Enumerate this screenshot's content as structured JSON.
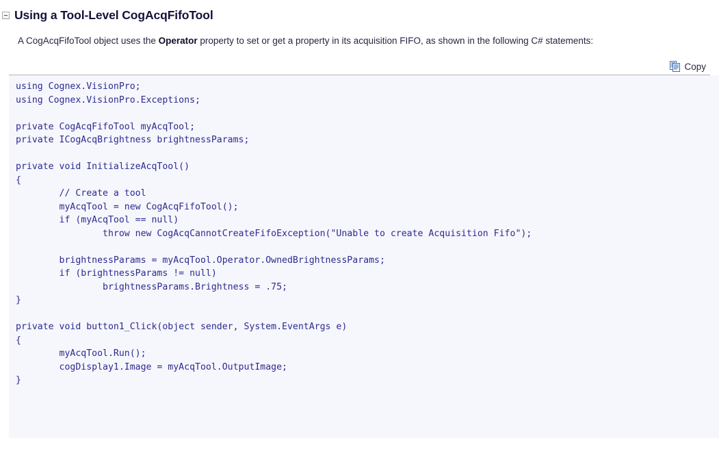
{
  "heading": {
    "collapse_icon": "minus-square-icon",
    "title": "Using a Tool-Level CogAcqFifoTool",
    "expanded": true
  },
  "intro": {
    "before_bold": "A CogAcqFifoTool object uses the ",
    "bold": "Operator",
    "after_bold": " property to set or get a property in its acquisition FIFO, as shown in the following C# statements:",
    "full_text": "A CogAcqFifoTool object uses the Operator property to set or get a property in its acquisition FIFO, as shown in the following C# statements:"
  },
  "code_toolbar": {
    "copy_icon": "copy-pages-icon",
    "copy_label": "Copy"
  },
  "code_block": {
    "language": "C#",
    "background_color": "#f6f6fd",
    "text_color": "#2b2b8f",
    "lines": [
      "using Cognex.VisionPro;",
      "using Cognex.VisionPro.Exceptions;",
      "",
      "private CogAcqFifoTool myAcqTool;",
      "private ICogAcqBrightness brightnessParams;",
      "",
      "private void InitializeAcqTool()",
      "{",
      "        // Create a tool",
      "        myAcqTool = new CogAcqFifoTool();",
      "        if (myAcqTool == null)",
      "                throw new CogAcqCannotCreateFifoException(\"Unable to create Acquisition Fifo\");",
      "",
      "        brightnessParams = myAcqTool.Operator.OwnedBrightnessParams;",
      "        if (brightnessParams != null)",
      "                brightnessParams.Brightness = .75;",
      "}",
      "",
      "private void button1_Click(object sender, System.EventArgs e)",
      "{",
      "        myAcqTool.Run();",
      "        cogDisplay1.Image = myAcqTool.OutputImage;",
      "}"
    ]
  }
}
